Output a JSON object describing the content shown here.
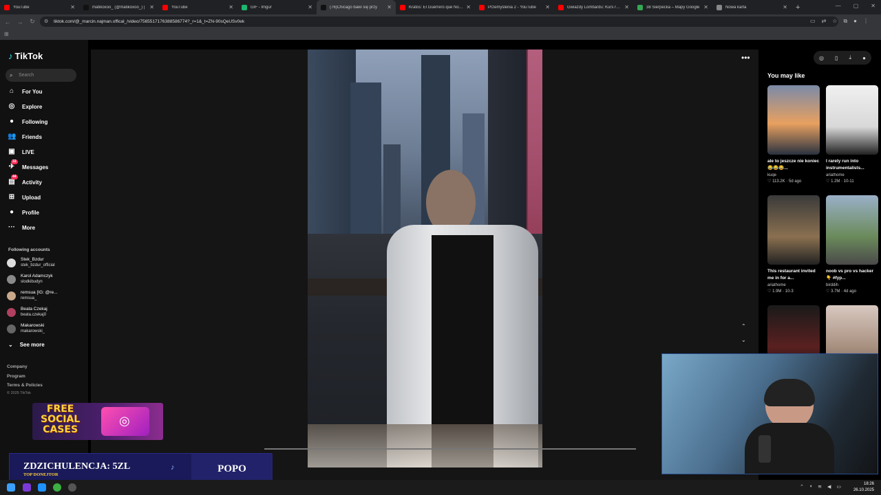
{
  "browser": {
    "tabs": [
      {
        "title": "YouTube",
        "color": "#ff0000"
      },
      {
        "title": "matikoxoo_ (@matikoxoo_) | ",
        "color": "#111111"
      },
      {
        "title": "YouTube",
        "color": "#ff0000"
      },
      {
        "title": "GIF - Imgur",
        "color": "#1bb76e"
      },
      {
        "title": "(76)Chicago bawi się przy",
        "color": "#111111",
        "active": true
      },
      {
        "title": "Kratos: El Guerrero que No Es",
        "color": "#ff0000"
      },
      {
        "title": "Przemyślenia 2 - YouTube",
        "color": "#ff0000"
      },
      {
        "title": "Gwiazdy Lombardu: Kurs rgbc",
        "color": "#ff0000"
      },
      {
        "title": "38 Sierpecka – Mapy Google",
        "color": "#34a853"
      },
      {
        "title": "Nowa karta",
        "color": "#888888"
      }
    ],
    "url": "tiktok.com/@_marcin.najman.offical_/video/7565517176388586774?_r=1&_t=ZN-90sQeUSv0ek"
  },
  "sidebar": {
    "logo": "TikTok",
    "search_placeholder": "Search",
    "nav": [
      {
        "label": "For You",
        "icon": "home-icon",
        "glyph": "⌂"
      },
      {
        "label": "Explore",
        "icon": "compass-icon",
        "glyph": "◎"
      },
      {
        "label": "Following",
        "icon": "following-avatar-icon",
        "glyph": "●"
      },
      {
        "label": "Friends",
        "icon": "friends-icon",
        "glyph": "👥"
      },
      {
        "label": "LIVE",
        "icon": "live-icon",
        "glyph": "▣"
      },
      {
        "label": "Messages",
        "icon": "messages-icon",
        "glyph": "✈",
        "badge": "33"
      },
      {
        "label": "Activity",
        "icon": "activity-icon",
        "glyph": "▤",
        "badge": "44"
      },
      {
        "label": "Upload",
        "icon": "upload-icon",
        "glyph": "⊞"
      },
      {
        "label": "Profile",
        "icon": "profile-avatar-icon",
        "glyph": "●"
      },
      {
        "label": "More",
        "icon": "more-icon",
        "glyph": "···"
      }
    ],
    "following_title": "Following accounts",
    "following": [
      {
        "name": "Stek_Bzdur",
        "handle": "stek_bzdur_official"
      },
      {
        "name": "Karol Adamczyk",
        "handle": "slodkibudyn"
      },
      {
        "name": "remsua [IG: @re...",
        "handle": "remsua_"
      },
      {
        "name": "Beata Czekaj",
        "handle": "beata.czekaj0"
      },
      {
        "name": "Makarowski",
        "handle": "makarowski_"
      }
    ],
    "see_more": "See more",
    "footer_links": [
      "Company",
      "Program",
      "Terms & Policies"
    ],
    "copyright": "© 2025 TikTok"
  },
  "right": {
    "title": "You may like",
    "cards": [
      {
        "caption": "ale to jeszcze nie koniec 😂😂😂...",
        "author": "kuqe",
        "likes": "113.2K",
        "age": "5d ago"
      },
      {
        "caption": "I rarely run into instrumentalists...",
        "author": "ariathome",
        "likes": "1.2M",
        "age": "10-11"
      },
      {
        "caption": "This restaurant invited me in for a...",
        "author": "ariathome",
        "likes": "1.9M",
        "age": "10-3"
      },
      {
        "caption": "noob vs pro vs hacker 👇 #fyp...",
        "author": "birddih",
        "likes": "3.7M",
        "age": "4d ago"
      },
      {
        "caption": "",
        "author": "",
        "likes": "",
        "age": ""
      },
      {
        "caption": "",
        "author": "",
        "likes": "",
        "age": ""
      }
    ]
  },
  "overlay": {
    "promo_line1": "FREE",
    "promo_line2": "SOCIAL",
    "promo_line3": "CASES",
    "donation_main": "ZDZICHULENCJA: 5ZL",
    "donation_sub": "TOP DONEJTOR",
    "donor_name": "POPO"
  },
  "taskbar": {
    "time": "18:26",
    "date": "26.10.2025"
  }
}
